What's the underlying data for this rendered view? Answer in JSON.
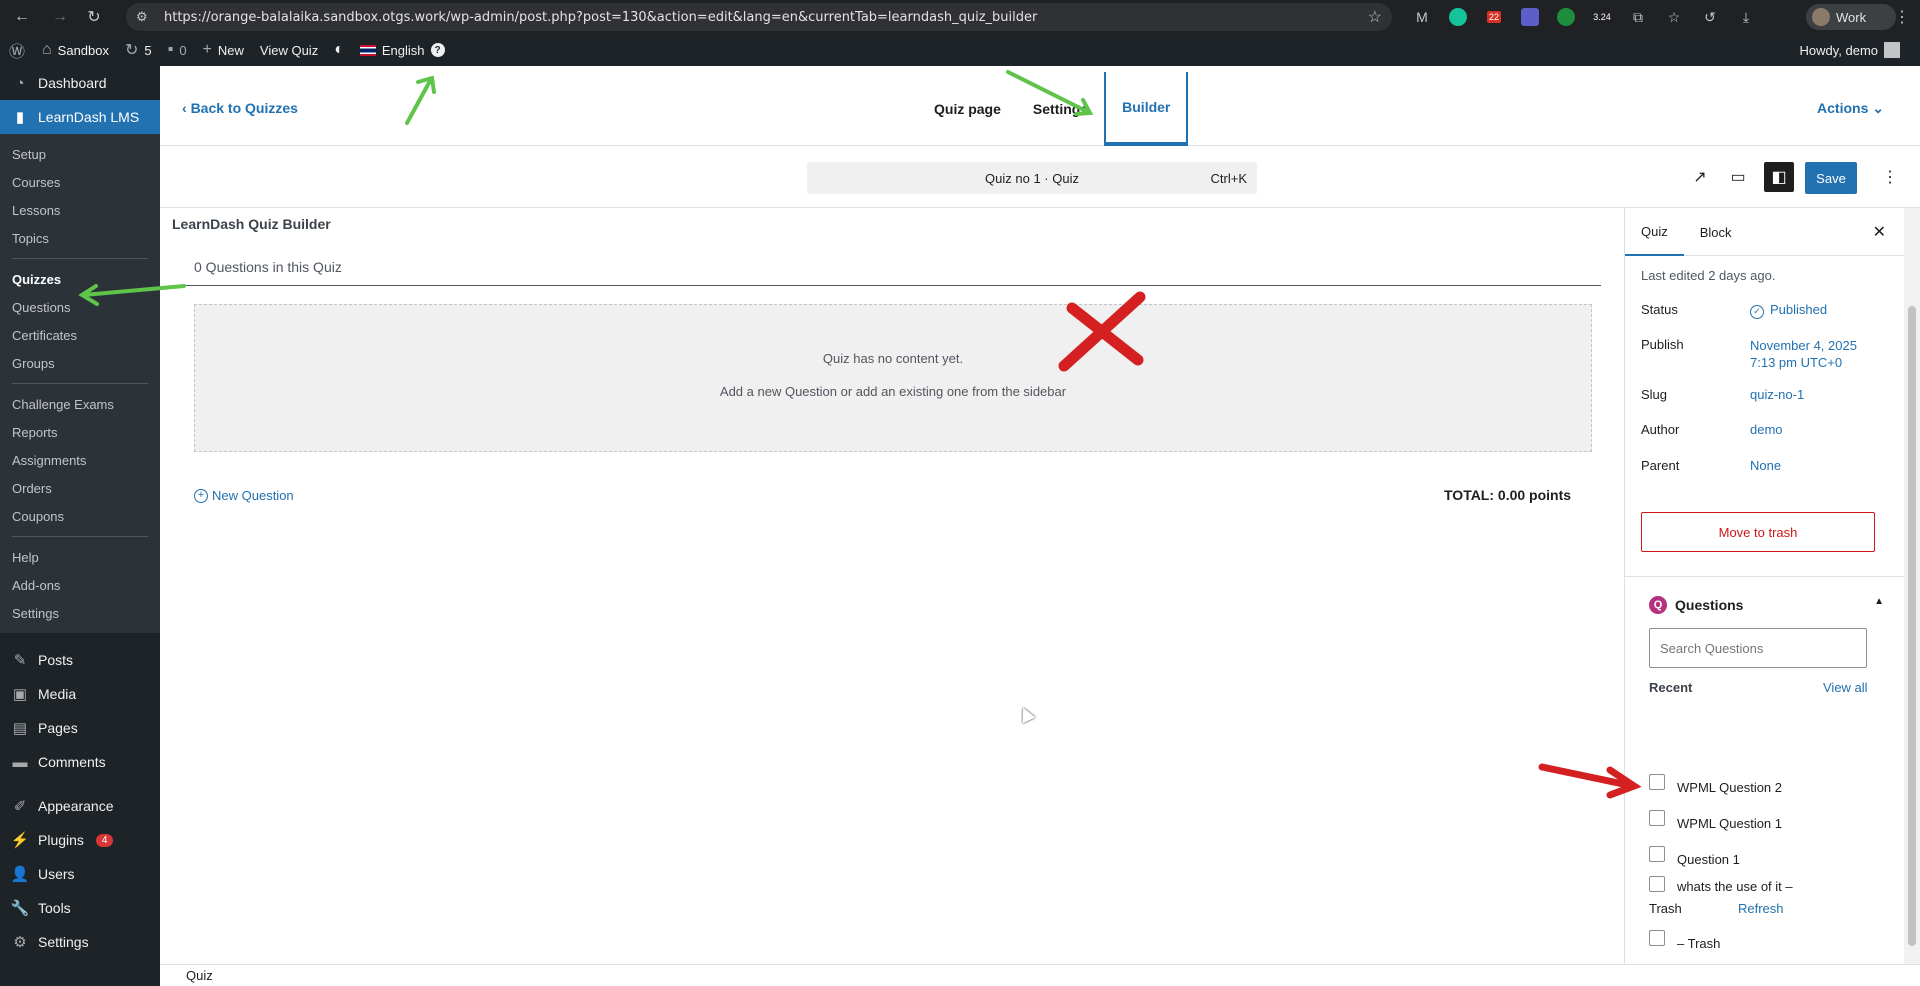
{
  "browser": {
    "url": "https://orange-balalaika.sandbox.otgs.work/wp-admin/post.php?post=130&action=edit&lang=en&currentTab=learndash_quiz_builder",
    "profile_label": "Work",
    "ext_badge_1": "22",
    "ext_badge_2": "3.24"
  },
  "adminbar": {
    "site_name": "Sandbox",
    "updates_count": "5",
    "comments_count": "0",
    "new_label": "New",
    "view_label": "View Quiz",
    "language": "English",
    "help": "?",
    "howdy": "Howdy, demo"
  },
  "sidebar": {
    "dashboard": "Dashboard",
    "learndash": "LearnDash LMS",
    "sub_group1": [
      "Setup",
      "Courses",
      "Lessons",
      "Topics"
    ],
    "sub_quizzes": "Quizzes",
    "sub_group2": [
      "Questions",
      "Certificates",
      "Groups"
    ],
    "sub_group3": [
      "Challenge Exams",
      "Reports",
      "Assignments",
      "Orders",
      "Coupons"
    ],
    "sub_group4": [
      "Help",
      "Add-ons",
      "Settings"
    ],
    "posts": "Posts",
    "media": "Media",
    "pages": "Pages",
    "comments": "Comments",
    "appearance": "Appearance",
    "plugins": "Plugins",
    "plugins_badge": "4",
    "users": "Users",
    "tools": "Tools",
    "settings": "Settings"
  },
  "header": {
    "back": "Back to Quizzes",
    "tabs": [
      "Quiz page",
      "Settings",
      "Builder"
    ],
    "actions": "Actions"
  },
  "toolbar": {
    "command_title": "Quiz no 1 · Quiz",
    "shortcut": "Ctrl+K",
    "save_label": "Save"
  },
  "builder": {
    "title": "LearnDash Quiz Builder",
    "count": "0 Questions in this Quiz",
    "empty_line1": "Quiz has no content yet.",
    "empty_line2": "Add a new Question or add an existing one from the sidebar",
    "new_question": "New Question",
    "total": "TOTAL: 0.00 points"
  },
  "footer": {
    "breadcrumb": "Quiz"
  },
  "panel": {
    "tab_quiz": "Quiz",
    "tab_block": "Block",
    "last_edited": "Last edited 2 days ago.",
    "status_label": "Status",
    "status_value": "Published",
    "publish_label": "Publish",
    "publish_date": "November 4, 2025",
    "publish_time": "7:13 pm UTC+0",
    "slug_label": "Slug",
    "slug_value": "quiz-no-1",
    "author_label": "Author",
    "author_value": "demo",
    "parent_label": "Parent",
    "parent_value": "None",
    "trash_label": "Move to trash",
    "questions_title": "Questions",
    "search_placeholder": "Search Questions",
    "recent_label": "Recent",
    "view_all": "View all",
    "questions": [
      "WPML Question 2",
      "WPML Question 1",
      "Question 1",
      "whats the use of it – Trash",
      " – Trash"
    ],
    "refresh": "Refresh"
  },
  "colors": {
    "wp_blue": "#2271b1",
    "admin_dark": "#1d2327",
    "annotation_green": "#5fc44a",
    "annotation_red": "#d42020"
  }
}
